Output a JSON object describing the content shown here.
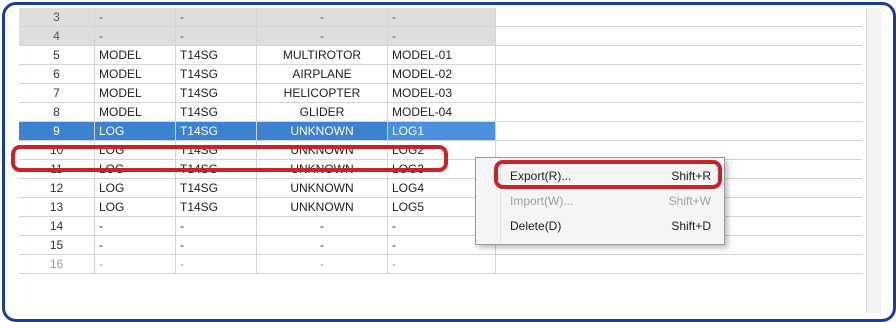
{
  "rows": [
    {
      "no": "3",
      "type": "-",
      "radio": "-",
      "category": "-",
      "name": "-",
      "style": "gray"
    },
    {
      "no": "4",
      "type": "-",
      "radio": "-",
      "category": "-",
      "name": "-",
      "style": "gray"
    },
    {
      "no": "5",
      "type": "MODEL",
      "radio": "T14SG",
      "category": "MULTIROTOR",
      "name": "MODEL-01",
      "style": ""
    },
    {
      "no": "6",
      "type": "MODEL",
      "radio": "T14SG",
      "category": "AIRPLANE",
      "name": "MODEL-02",
      "style": ""
    },
    {
      "no": "7",
      "type": "MODEL",
      "radio": "T14SG",
      "category": "HELICOPTER",
      "name": "MODEL-03",
      "style": ""
    },
    {
      "no": "8",
      "type": "MODEL",
      "radio": "T14SG",
      "category": "GLIDER",
      "name": "MODEL-04",
      "style": ""
    },
    {
      "no": "9",
      "type": "LOG",
      "radio": "T14SG",
      "category": "UNKNOWN",
      "name": "LOG1",
      "style": "sel"
    },
    {
      "no": "10",
      "type": "LOG",
      "radio": "T14SG",
      "category": "UNKNOWN",
      "name": "LOG2",
      "style": ""
    },
    {
      "no": "11",
      "type": "LOG",
      "radio": "T14SG",
      "category": "UNKNOWN",
      "name": "LOG3",
      "style": ""
    },
    {
      "no": "12",
      "type": "LOG",
      "radio": "T14SG",
      "category": "UNKNOWN",
      "name": "LOG4",
      "style": ""
    },
    {
      "no": "13",
      "type": "LOG",
      "radio": "T14SG",
      "category": "UNKNOWN",
      "name": "LOG5",
      "style": ""
    },
    {
      "no": "14",
      "type": "-",
      "radio": "-",
      "category": "-",
      "name": "-",
      "style": ""
    },
    {
      "no": "15",
      "type": "-",
      "radio": "-",
      "category": "-",
      "name": "-",
      "style": ""
    },
    {
      "no": "16",
      "type": "-",
      "radio": "-",
      "category": "-",
      "name": "-",
      "style": "faded"
    }
  ],
  "context_menu": {
    "items": [
      {
        "label": "Export(R)...",
        "shortcut": "Shift+R",
        "disabled": false
      },
      {
        "label": "Import(W)...",
        "shortcut": "Shift+W",
        "disabled": true
      },
      {
        "label": "Delete(D)",
        "shortcut": "Shift+D",
        "disabled": false
      }
    ]
  },
  "colors": {
    "selection": "#3b82d0",
    "callout_border": "#c8232c",
    "frame_border": "#1d3f8f"
  }
}
